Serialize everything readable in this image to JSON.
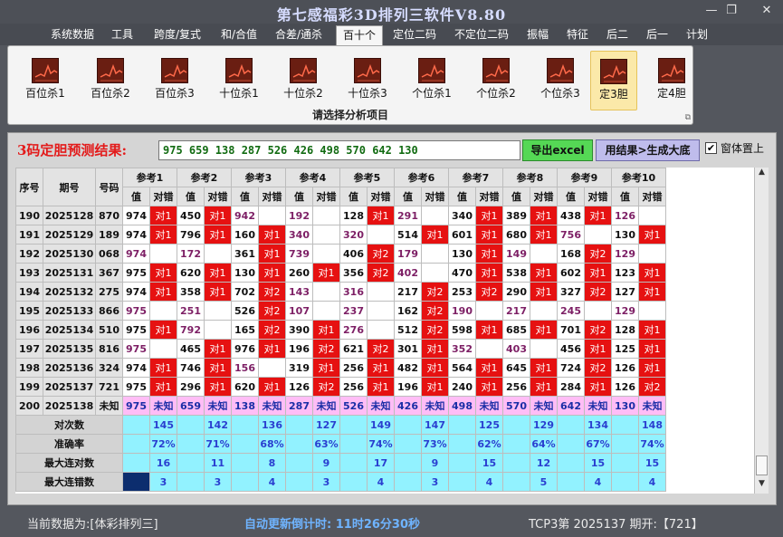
{
  "window": {
    "title": "第七感福彩3D排列三软件V8.80",
    "minimize": "—",
    "restore": "❐",
    "close": "✕"
  },
  "menu": [
    "系统数据",
    "工具",
    "跨度/复式",
    "和/合值",
    "合差/通杀",
    "百十个",
    "定位二码",
    "不定位二码",
    "振幅",
    "特征",
    "后二",
    "后一",
    "计划"
  ],
  "menu_active": "百十个",
  "ribbon": {
    "buttons": [
      {
        "label": "百位杀1",
        "icon": "line-chart-icon"
      },
      {
        "label": "百位杀2",
        "icon": "line-chart-icon"
      },
      {
        "label": "百位杀3",
        "icon": "line-chart-icon"
      },
      {
        "label": "十位杀1",
        "icon": "line-chart-icon"
      },
      {
        "label": "十位杀2",
        "icon": "line-chart-icon"
      },
      {
        "label": "十位杀3",
        "icon": "line-chart-icon"
      },
      {
        "label": "个位杀1",
        "icon": "line-chart-icon"
      },
      {
        "label": "个位杀2",
        "icon": "line-chart-icon"
      },
      {
        "label": "个位杀3",
        "icon": "line-chart-icon"
      },
      {
        "label": "定3胆",
        "icon": "line-chart-icon"
      },
      {
        "label": "定4胆",
        "icon": "line-chart-icon"
      }
    ],
    "active": "定3胆",
    "section_label": "请选择分析项目"
  },
  "prediction": {
    "label": "3码定胆预测结果:",
    "value": "975 659 138 287 526 426 498 570 642 130",
    "export_button": "导出excel",
    "generate_button": "用结果>生成大底",
    "checkbox_checked": "✔",
    "checkbox_label": "窗体置上"
  },
  "table": {
    "headers": {
      "seq": "序号",
      "period": "期号",
      "number": "号码",
      "ref_prefix": "参考",
      "value": "值",
      "hit": "对错"
    },
    "refs": [
      "参考1",
      "参考2",
      "参考3",
      "参考4",
      "参考5",
      "参考6",
      "参考7",
      "参考8",
      "参考9",
      "参考10"
    ],
    "rows": [
      {
        "seq": "190",
        "period": "2025128",
        "num": "870",
        "cells": [
          [
            "974",
            "对1"
          ],
          [
            "450",
            "对1"
          ],
          [
            "942",
            ""
          ],
          [
            "192",
            ""
          ],
          [
            "128",
            "对1"
          ],
          [
            "291",
            ""
          ],
          [
            "340",
            "对1"
          ],
          [
            "389",
            "对1"
          ],
          [
            "438",
            "对1"
          ],
          [
            "126",
            ""
          ]
        ]
      },
      {
        "seq": "191",
        "period": "2025129",
        "num": "189",
        "cells": [
          [
            "974",
            "对1"
          ],
          [
            "796",
            "对1"
          ],
          [
            "160",
            "对1"
          ],
          [
            "340",
            ""
          ],
          [
            "320",
            ""
          ],
          [
            "514",
            "对1"
          ],
          [
            "601",
            "对1"
          ],
          [
            "680",
            "对1"
          ],
          [
            "756",
            ""
          ],
          [
            "130",
            "对1"
          ]
        ]
      },
      {
        "seq": "192",
        "period": "2025130",
        "num": "068",
        "cells": [
          [
            "974",
            ""
          ],
          [
            "172",
            ""
          ],
          [
            "361",
            "对1"
          ],
          [
            "739",
            ""
          ],
          [
            "406",
            "对2"
          ],
          [
            "179",
            ""
          ],
          [
            "130",
            "对1"
          ],
          [
            "149",
            ""
          ],
          [
            "168",
            "对2"
          ],
          [
            "129",
            ""
          ]
        ]
      },
      {
        "seq": "193",
        "period": "2025131",
        "num": "367",
        "cells": [
          [
            "975",
            "对1"
          ],
          [
            "620",
            "对1"
          ],
          [
            "130",
            "对1"
          ],
          [
            "260",
            "对1"
          ],
          [
            "356",
            "对2"
          ],
          [
            "402",
            ""
          ],
          [
            "470",
            "对1"
          ],
          [
            "538",
            "对1"
          ],
          [
            "602",
            "对1"
          ],
          [
            "123",
            "对1"
          ]
        ]
      },
      {
        "seq": "194",
        "period": "2025132",
        "num": "275",
        "cells": [
          [
            "974",
            "对1"
          ],
          [
            "358",
            "对1"
          ],
          [
            "702",
            "对2"
          ],
          [
            "143",
            ""
          ],
          [
            "316",
            ""
          ],
          [
            "217",
            "对2"
          ],
          [
            "253",
            "对2"
          ],
          [
            "290",
            "对1"
          ],
          [
            "327",
            "对2"
          ],
          [
            "127",
            "对1"
          ]
        ]
      },
      {
        "seq": "195",
        "period": "2025133",
        "num": "866",
        "cells": [
          [
            "975",
            ""
          ],
          [
            "251",
            ""
          ],
          [
            "526",
            "对2"
          ],
          [
            "107",
            ""
          ],
          [
            "237",
            ""
          ],
          [
            "162",
            "对2"
          ],
          [
            "190",
            ""
          ],
          [
            "217",
            ""
          ],
          [
            "245",
            ""
          ],
          [
            "129",
            ""
          ]
        ]
      },
      {
        "seq": "196",
        "period": "2025134",
        "num": "510",
        "cells": [
          [
            "975",
            "对1"
          ],
          [
            "792",
            ""
          ],
          [
            "165",
            "对2"
          ],
          [
            "390",
            "对1"
          ],
          [
            "276",
            ""
          ],
          [
            "512",
            "对2"
          ],
          [
            "598",
            "对1"
          ],
          [
            "685",
            "对1"
          ],
          [
            "701",
            "对2"
          ],
          [
            "128",
            "对1"
          ]
        ]
      },
      {
        "seq": "197",
        "period": "2025135",
        "num": "816",
        "cells": [
          [
            "975",
            ""
          ],
          [
            "465",
            "对1"
          ],
          [
            "976",
            "对1"
          ],
          [
            "196",
            "对2"
          ],
          [
            "621",
            "对2"
          ],
          [
            "301",
            "对1"
          ],
          [
            "352",
            ""
          ],
          [
            "403",
            ""
          ],
          [
            "456",
            "对1"
          ],
          [
            "125",
            "对1"
          ]
        ]
      },
      {
        "seq": "198",
        "period": "2025136",
        "num": "324",
        "cells": [
          [
            "974",
            "对1"
          ],
          [
            "746",
            "对1"
          ],
          [
            "156",
            ""
          ],
          [
            "319",
            "对1"
          ],
          [
            "256",
            "对1"
          ],
          [
            "482",
            "对1"
          ],
          [
            "564",
            "对1"
          ],
          [
            "645",
            "对1"
          ],
          [
            "724",
            "对2"
          ],
          [
            "126",
            "对1"
          ]
        ]
      },
      {
        "seq": "199",
        "period": "2025137",
        "num": "721",
        "cells": [
          [
            "975",
            "对1"
          ],
          [
            "296",
            "对1"
          ],
          [
            "620",
            "对1"
          ],
          [
            "126",
            "对2"
          ],
          [
            "256",
            "对1"
          ],
          [
            "196",
            "对1"
          ],
          [
            "240",
            "对1"
          ],
          [
            "256",
            "对1"
          ],
          [
            "284",
            "对1"
          ],
          [
            "126",
            "对2"
          ]
        ]
      },
      {
        "seq": "200",
        "period": "2025138",
        "num": "未知",
        "cells": [
          [
            "975",
            "未知"
          ],
          [
            "659",
            "未知"
          ],
          [
            "138",
            "未知"
          ],
          [
            "287",
            "未知"
          ],
          [
            "526",
            "未知"
          ],
          [
            "426",
            "未知"
          ],
          [
            "498",
            "未知"
          ],
          [
            "570",
            "未知"
          ],
          [
            "642",
            "未知"
          ],
          [
            "130",
            "未知"
          ]
        ]
      }
    ],
    "stats": [
      {
        "label": "对次数",
        "values": [
          "145",
          "142",
          "136",
          "127",
          "149",
          "147",
          "125",
          "129",
          "134",
          "148"
        ]
      },
      {
        "label": "准确率",
        "values": [
          "72%",
          "71%",
          "68%",
          "63%",
          "74%",
          "73%",
          "62%",
          "64%",
          "67%",
          "74%"
        ]
      },
      {
        "label": "最大连对数",
        "values": [
          "16",
          "11",
          "8",
          "9",
          "17",
          "9",
          "15",
          "12",
          "15",
          "15"
        ]
      },
      {
        "label": "最大连错数",
        "values": [
          "3",
          "3",
          "4",
          "3",
          "4",
          "3",
          "4",
          "5",
          "4",
          "4"
        ]
      }
    ]
  },
  "status": {
    "current_data": "当前数据为:[体彩排列三]",
    "countdown": "自动更新倒计时: 11时26分30秒",
    "draw_info": "TCP3第 2025137 期开:【721】"
  },
  "colors": {
    "hit": "#e61111",
    "unknown": "#ffbdf6",
    "stats": "#92f2ff",
    "header": "#e3e3e3",
    "prediction_label": "#e31b1b",
    "prediction_value": "#116b11"
  }
}
